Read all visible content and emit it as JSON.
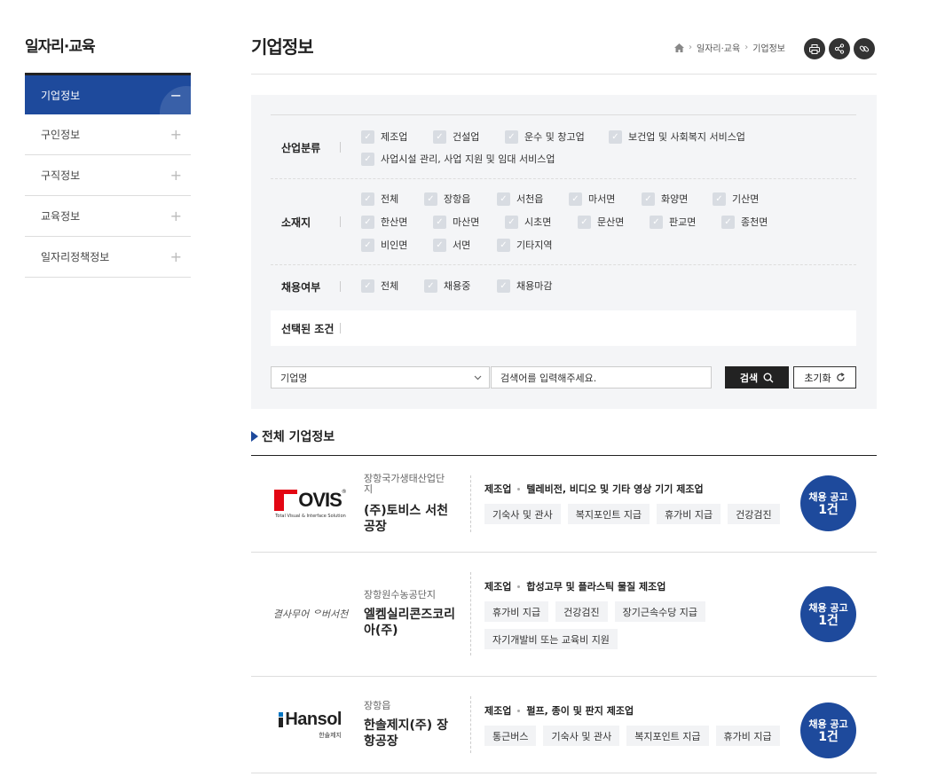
{
  "sidebar": {
    "title": "일자리·교육",
    "items": [
      {
        "label": "기업정보",
        "sign": "−"
      },
      {
        "label": "구인정보",
        "sign": "+"
      },
      {
        "label": "구직정보",
        "sign": "+"
      },
      {
        "label": "교육정보",
        "sign": "+"
      },
      {
        "label": "일자리정책정보",
        "sign": "+"
      }
    ]
  },
  "header": {
    "title": "기업정보",
    "breadcrumb": [
      "일자리·교육",
      "기업정보"
    ]
  },
  "filter": {
    "industry": {
      "label": "산업분류",
      "options": [
        "제조업",
        "건설업",
        "운수 및 창고업",
        "보건업 및 사회복지 서비스업",
        "사업시설 관리, 사업 지원 및 임대 서비스업"
      ]
    },
    "location": {
      "label": "소재지",
      "options": [
        "전체",
        "장항읍",
        "서천읍",
        "마서면",
        "화양면",
        "기산면",
        "한산면",
        "마산면",
        "시초면",
        "문산면",
        "판교면",
        "종천면",
        "비인면",
        "서면",
        "기타지역"
      ]
    },
    "hiring": {
      "label": "채용여부",
      "options": [
        "전체",
        "채용중",
        "채용마감"
      ]
    },
    "selected_label": "선택된 조건"
  },
  "search": {
    "select_value": "기업명",
    "placeholder": "검색어를 입력해주세요.",
    "search_label": "검색",
    "reset_label": "초기화"
  },
  "list": {
    "title": "전체 기업정보",
    "companies": [
      {
        "location": "장항국가생태산업단지",
        "name": "(주)토비스 서천공장",
        "industry": "제조업",
        "detail": "텔레비전, 비디오 및 기타 영상 기기 제조업",
        "benefits": [
          "기숙사 및 관사",
          "복지포인트 지급",
          "휴가비 지급",
          "건강검진"
        ],
        "badge_label": "채용 공고",
        "badge_count": "1건",
        "logo_text": "TOVIS",
        "logo_sub": "Total Visual & Interface Solution"
      },
      {
        "location": "장항원수농공단지",
        "name": "엘켐실리콘즈코리아(주)",
        "industry": "제조업",
        "detail": "합성고무 및 플라스틱 물질 제조업",
        "benefits": [
          "휴가비 지급",
          "건강검진",
          "장기근속수당 지급",
          "자기개발비 또는 교육비 지원"
        ],
        "badge_label": "채용 공고",
        "badge_count": "1건",
        "logo_text": "결사무어 ᄋ버서천"
      },
      {
        "location": "장항읍",
        "name": "한솔제지(주) 장항공장",
        "industry": "제조업",
        "detail": "펄프, 종이 및 판지 제조업",
        "benefits": [
          "통근버스",
          "기숙사 및 관사",
          "복지포인트 지급",
          "휴가비 지급"
        ],
        "badge_label": "채용 공고",
        "badge_count": "1건",
        "logo_text": "Hansol",
        "logo_sub": "한솔제지"
      }
    ]
  },
  "colors": {
    "primary": "#1e4a9c",
    "dark": "#222222",
    "filter_bg": "#f4f5f7",
    "tovis_red": "#e30613"
  }
}
